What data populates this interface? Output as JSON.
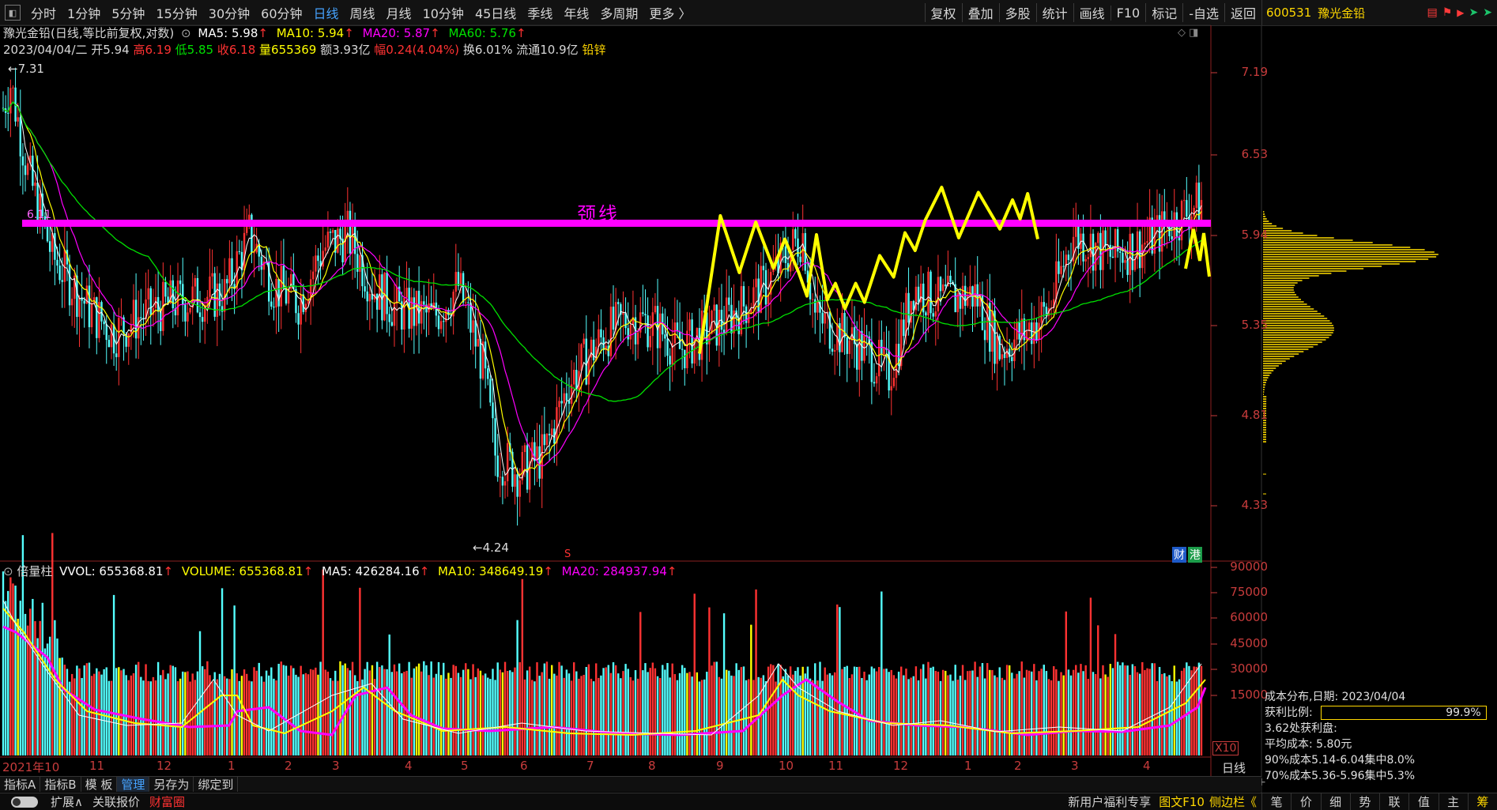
{
  "toolbar": {
    "periods": [
      "分时",
      "1分钟",
      "5分钟",
      "15分钟",
      "30分钟",
      "60分钟",
      "日线",
      "周线",
      "月线",
      "10分钟",
      "45日线",
      "季线",
      "年线",
      "多周期",
      "更多 〉"
    ],
    "active_period": "日线",
    "right_buttons": [
      "复权",
      "叠加",
      "多股",
      "统计",
      "画线",
      "F10",
      "标记",
      "-自选",
      "返回"
    ]
  },
  "stock": {
    "code": "600531",
    "name": "豫光金铅"
  },
  "chart_header": {
    "title": "豫光金铅(日线,等比前复权,对数)",
    "ma5": "MA5: 5.98",
    "ma10": "MA10: 5.94",
    "ma20": "MA20: 5.87",
    "ma60": "MA60: 5.76",
    "date": "2023/04/04/二",
    "open": "开5.94",
    "high": "高6.19",
    "low": "低5.85",
    "close": "收6.18",
    "volume": "量655369",
    "amount": "额3.93亿",
    "change": "幅0.24(4.04%)",
    "turnover": "换6.01%",
    "float_value": "流通10.9亿",
    "sector": "铅锌"
  },
  "price_axis": [
    "7.19",
    "6.53",
    "5.94",
    "5.35",
    "4.81",
    "4.33"
  ],
  "annotations": {
    "high_mark": "7.31",
    "low_mark": "4.24",
    "neckline": "颈线",
    "neck_value": "6.11",
    "s_mark": "S"
  },
  "badges": [
    "财",
    "港"
  ],
  "volume_header": {
    "name": "倍量柱",
    "vvol": "VVOL: 655368.81",
    "volume": "VOLUME: 655368.81",
    "ma5": "MA5: 426284.16",
    "ma10": "MA10: 348649.19",
    "ma20": "MA20: 284937.94"
  },
  "volume_axis": [
    "90000",
    "75000",
    "60000",
    "45000",
    "30000",
    "15000"
  ],
  "volume_unit": "X10",
  "months": [
    "2021年10",
    "11",
    "12",
    "1",
    "2",
    "3",
    "4",
    "5",
    "6",
    "7",
    "8",
    "9",
    "10",
    "11",
    "12",
    "1",
    "2",
    "3",
    "4"
  ],
  "period_label": "日线",
  "cost": {
    "title": "成本分布,日期: 2023/04/04",
    "profit_label": "获利比例:",
    "profit_value": "99.9%",
    "profit_ratio": 0.999,
    "line1": "3.62处获利盘:",
    "line2": "平均成本: 5.80元",
    "line3": "90%成本5.14-6.04集中8.0%",
    "line4": "70%成本5.36-5.96集中5.3%"
  },
  "bottom_tabs": [
    "指标A",
    "指标B",
    "模 板",
    "管理",
    "另存为",
    "绑定到"
  ],
  "bottom_row2": [
    "扩展∧",
    "关联报价",
    "财富圈"
  ],
  "status_right": [
    "新用户福利专享",
    "图文F10",
    "侧边栏《"
  ],
  "right_bottom_tabs": [
    "笔",
    "价",
    "细",
    "势",
    "联",
    "值",
    "主",
    "筹"
  ],
  "colors": {
    "up": "#ff3232",
    "down": "#54ffff",
    "ma5": "#ffffff",
    "ma10": "#ffff00",
    "ma20": "#ff00ff",
    "ma60": "#00e000",
    "neckline": "#ff00ff",
    "accent": "#46a3ff"
  }
}
